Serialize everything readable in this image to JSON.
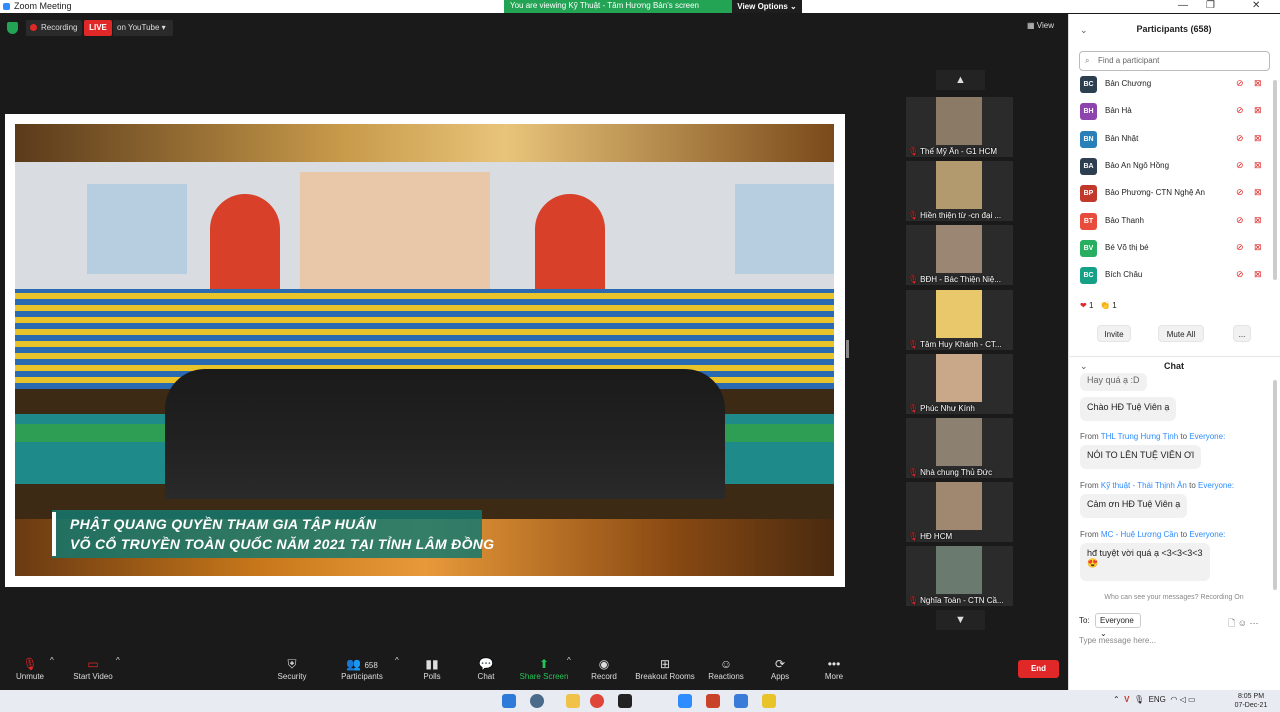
{
  "titlebar": {
    "title": "Zoom Meeting",
    "minimize": "—",
    "restore": "❐",
    "close": "✕"
  },
  "banner": {
    "message": "You are viewing Kỹ Thuật - Tâm Hương Bản's screen",
    "view_options": "View Options ⌄"
  },
  "top_controls": {
    "recording": "Recording",
    "live": "LIVE",
    "on_youtube": "on YouTube ▾",
    "view": "View"
  },
  "video": {
    "caption_line1": "PHẬT QUANG QUYỀN THAM GIA TẬP HUẤN",
    "caption_line2": "VÕ CỔ TRUYỀN TOÀN QUỐC NĂM 2021 TẠI TỈNH LÂM ĐỒNG"
  },
  "gallery": {
    "up": "▲",
    "down": "▼",
    "tiles": [
      {
        "name": "Thế Mỹ Ân - G1 HCM",
        "photo": "#8a7a66"
      },
      {
        "name": "Hiền thiện từ -cn đại ...",
        "photo": "#b29a6e"
      },
      {
        "name": "BĐH - Bác Thiện Niệ...",
        "photo": "#9a8672"
      },
      {
        "name": "Tâm Huy Khánh - CT...",
        "photo": "#e8c86a"
      },
      {
        "name": "Phúc Như Kính",
        "photo": "#c8a888"
      },
      {
        "name": "Nhà chung Thủ Đức",
        "photo": "#8c8070"
      },
      {
        "name": "HĐ HCM",
        "photo": "#a08870"
      },
      {
        "name": "Nghĩa Toàn - CTN Cầ...",
        "photo": "#6a7a6e"
      }
    ]
  },
  "toolbar": {
    "unmute": "Unmute",
    "start_video": "Start Video",
    "security": "Security",
    "participants": "Participants",
    "participants_count": "658",
    "polls": "Polls",
    "chat": "Chat",
    "share_screen": "Share Screen",
    "record": "Record",
    "breakout_rooms": "Breakout Rooms",
    "reactions": "Reactions",
    "apps": "Apps",
    "more": "More",
    "end": "End"
  },
  "participants_panel": {
    "title": "Participants (658)",
    "search_placeholder": "Find a participant",
    "people": [
      {
        "initials": "BC",
        "name": "Bản Chương",
        "color": "#2c3e50"
      },
      {
        "initials": "BH",
        "name": "Bản Hà",
        "color": "#8e44ad"
      },
      {
        "initials": "BN",
        "name": "Bản Nhật",
        "color": "#2980b9"
      },
      {
        "initials": "BA",
        "name": "Bảo An Ngô Hồng",
        "color": "#2c3e50"
      },
      {
        "initials": "BP",
        "name": "Bảo Phương- CTN Nghệ An",
        "color": "#c0392b"
      },
      {
        "initials": "BT",
        "name": "Bảo Thanh",
        "color": "#e74c3c"
      },
      {
        "initials": "BV",
        "name": "Bé Võ thị bé",
        "color": "#27ae60"
      },
      {
        "initials": "BC",
        "name": "Bích Châu",
        "color": "#16a085"
      }
    ],
    "reactions": {
      "heart": "❤",
      "heart_count": "1",
      "clap": "👏",
      "clap_count": "1"
    },
    "invite": "Invite",
    "mute_all": "Mute All",
    "more": "..."
  },
  "chat_panel": {
    "title": "Chat",
    "messages": [
      {
        "from": "",
        "to": "",
        "text": "Hay quá ạ :D"
      },
      {
        "from": "",
        "to": "",
        "text": "Chào HĐ Tuệ Viên ạ"
      },
      {
        "from": "THL Trung Hưng Tịnh",
        "to": "Everyone:",
        "text": "NÓI TO LÊN TUỆ VIÊN ƠI"
      },
      {
        "from": "Kỹ thuật - Thái Thịnh Ân",
        "to": "Everyone:",
        "text": "Cảm ơn HĐ Tuệ Viên ạ"
      },
      {
        "from": "MC - Huệ Lương Cần",
        "to": "Everyone:",
        "text": "hđ tuyệt vời quá ạ <3<3<3<3"
      }
    ],
    "from_label": "From",
    "to_label": "to",
    "who_can_see": "Who can see your messages? Recording On",
    "to_prefix": "To:",
    "recipient": "Everyone ⌄",
    "input_placeholder": "Type message here..."
  },
  "taskbar": {
    "lang": "ENG",
    "time": "8:05 PM",
    "date": "07-Dec-21"
  }
}
